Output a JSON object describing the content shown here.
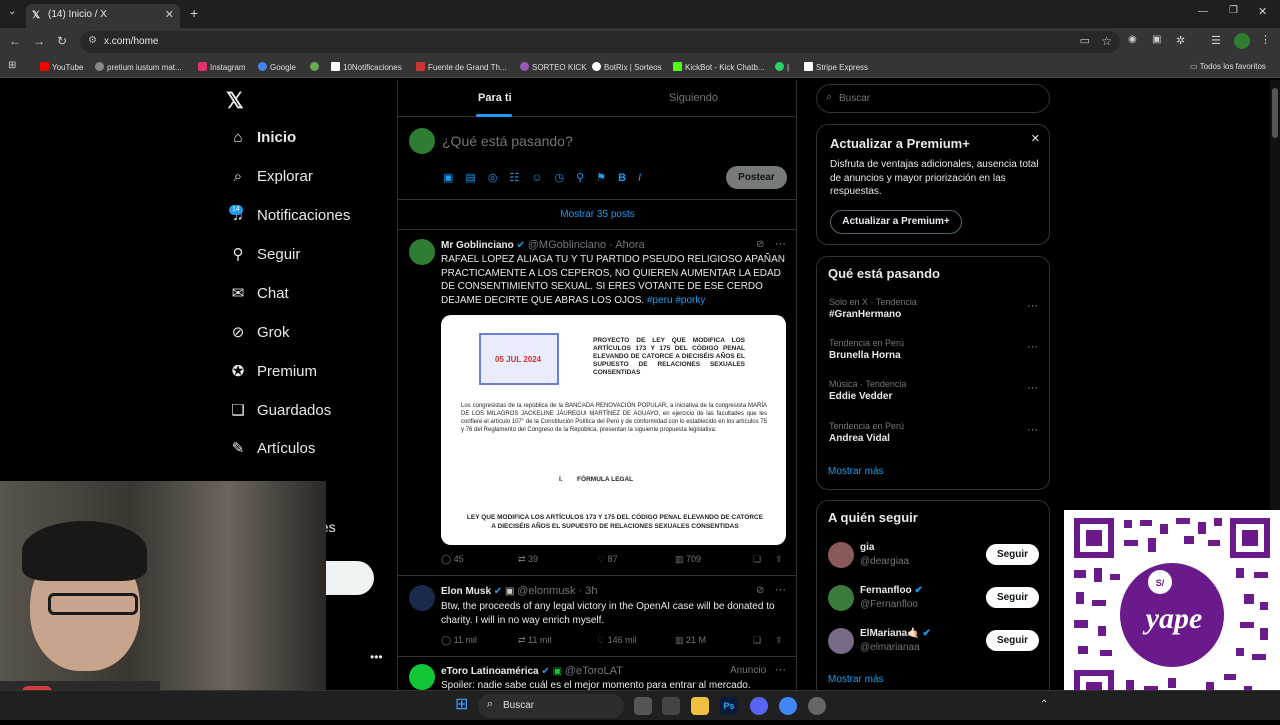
{
  "browser": {
    "tab_title": "(14) Inicio / X",
    "tab_count_button": "⌄",
    "url": "x.com/home",
    "bookmarks": [
      {
        "label": "YouTube",
        "color": "#ff0000"
      },
      {
        "label": "pretium iustum mat...",
        "color": "#888888"
      },
      {
        "label": "Instagram",
        "color": "#e1306c"
      },
      {
        "label": "Google",
        "color": "#4285f4"
      },
      {
        "label": "",
        "color": "#6aa84f"
      },
      {
        "label": "10Notificaciones",
        "color": "#ffffff"
      },
      {
        "label": "Fuente de Grand Th...",
        "color": "#cc3333"
      },
      {
        "label": "SORTEO KICK",
        "color": "#9b59b6"
      },
      {
        "label": "BotRix | Sorteos",
        "color": "#ffffff"
      },
      {
        "label": "KickBot - Kick Chatb...",
        "color": "#53fc18"
      },
      {
        "label": "|",
        "color": "#25d366"
      },
      {
        "label": "Stripe Express",
        "color": "#ffffff"
      }
    ],
    "all_favorites": "Todos los favoritos"
  },
  "nav": {
    "items": [
      {
        "label": "Inicio",
        "icon": "home-icon",
        "glyph": "⌂"
      },
      {
        "label": "Explorar",
        "icon": "search-icon",
        "glyph": "⌕"
      },
      {
        "label": "Notificaciones",
        "icon": "bell-icon",
        "glyph": "♫"
      },
      {
        "label": "Seguir",
        "icon": "person-plus-icon",
        "glyph": "⚲"
      },
      {
        "label": "Chat",
        "icon": "mail-icon",
        "glyph": "✉"
      },
      {
        "label": "Grok",
        "icon": "grok-icon",
        "glyph": "⊘"
      },
      {
        "label": "Premium",
        "icon": "premium-icon",
        "glyph": "✪"
      },
      {
        "label": "Guardados",
        "icon": "bookmark-icon",
        "glyph": "❑"
      },
      {
        "label": "Artículos",
        "icon": "article-icon",
        "glyph": "✎"
      }
    ],
    "notif_badge": "14",
    "partial_label": "nes"
  },
  "feed": {
    "tabs": [
      "Para ti",
      "Siguiendo"
    ],
    "compose_placeholder": "¿Qué está pasando?",
    "post_button": "Postear",
    "show_posts": "Mostrar 35 posts",
    "posts": [
      {
        "name": "Mr Goblinciano",
        "handle": "@MGoblinciano · Ahora",
        "text": "RAFAEL LOPEZ ALIAGA TU Y TU PARTIDO PSEUDO RELIGIOSO APAÑAN PRACTICAMENTE A LOS CEPEROS, NO QUIEREN AUMENTAR LA EDAD DE CONSENTIMIENTO SEXUAL. SI ERES VOTANTE DE ESE CERDO DEJAME DECIRTE QUE ABRAS LOS OJOS.",
        "hashtags": "#peru  #porky",
        "stats": [
          "45",
          "39",
          "87",
          "709"
        ]
      },
      {
        "name": "Elon Musk",
        "handle": "@elonmusk · 3h",
        "text": "Btw, the proceeds of any legal victory in the OpenAI case will be donated to charity. I will in no way enrich myself.",
        "stats": [
          "11 mil",
          "11 mil",
          "146 mil",
          "21 M"
        ]
      },
      {
        "name": "eToro Latinoamérica",
        "handle": "@eToroLAT",
        "ad": "Anuncio",
        "text": "Spoiler: nadie sabe cuál es el mejor momento para entrar al mercado."
      }
    ],
    "document": {
      "stamp": "05 JUL 2024",
      "title": "PROYECTO DE LEY QUE MODIFICA LOS ARTÍCULOS 173 Y 175 DEL CÓDIGO PENAL ELEVANDO DE CATORCE A DIECISÉIS AÑOS EL SUPUESTO DE RELACIONES SEXUALES CONSENTIDAS",
      "body": "Los congresistas de la república de la BANCADA RENOVACIÓN POPULAR, a iniciativa de la congresista MARÍA DE LOS MILAGROS JACKELINE JÁUREGUI MARTÍNEZ DE AGUAYO, en ejercicio de las facultades que les confiere el artículo 107° de la Constitución Política del Perú y de conformidad con lo establecido en los artículos 75 y 76 del Reglamento del Congreso de la República, presentan la siguiente propuesta legislativa:",
      "section": "I.        FÓRMULA LEGAL",
      "law": "LEY QUE MODIFICA LOS ARTÍCULOS 173 Y 175 DEL CÓDIGO PENAL ELEVANDO DE CATORCE A DIECISÉIS AÑOS EL SUPUESTO DE RELACIONES SEXUALES CONSENTIDAS"
    }
  },
  "sidebar": {
    "search_placeholder": "Buscar",
    "premium": {
      "title": "Actualizar a Premium+",
      "body": "Disfruta de ventajas adicionales, ausencia total de anuncios y mayor priorización en las respuestas.",
      "button": "Actualizar a Premium+"
    },
    "trends_title": "Qué está pasando",
    "trends": [
      {
        "context": "Solo en X · Tendencia",
        "name": "#GranHermano"
      },
      {
        "context": "Tendencia en Perú",
        "name": "Brunella Horna"
      },
      {
        "context": "Música · Tendencia",
        "name": "Eddie Vedder"
      },
      {
        "context": "Tendencia en Perú",
        "name": "Andrea Vidal"
      }
    ],
    "show_more": "Mostrar más",
    "follow_title": "A quién seguir",
    "follow": [
      {
        "name": "gia",
        "handle": "@deargiaa",
        "button": "Seguir",
        "color": "#8a5a5a"
      },
      {
        "name": "Fernanfloo",
        "handle": "@Fernanfloo",
        "button": "Seguir",
        "color": "#3a7a3a"
      },
      {
        "name": "ElMariana🤙🏻",
        "handle": "@elmarianaa",
        "button": "Seguir",
        "color": "#7a6a8a"
      }
    ],
    "show_more_2": "Mostrar más"
  },
  "taskbar": {
    "search": "Buscar"
  },
  "qr": {
    "brand": "yape"
  }
}
